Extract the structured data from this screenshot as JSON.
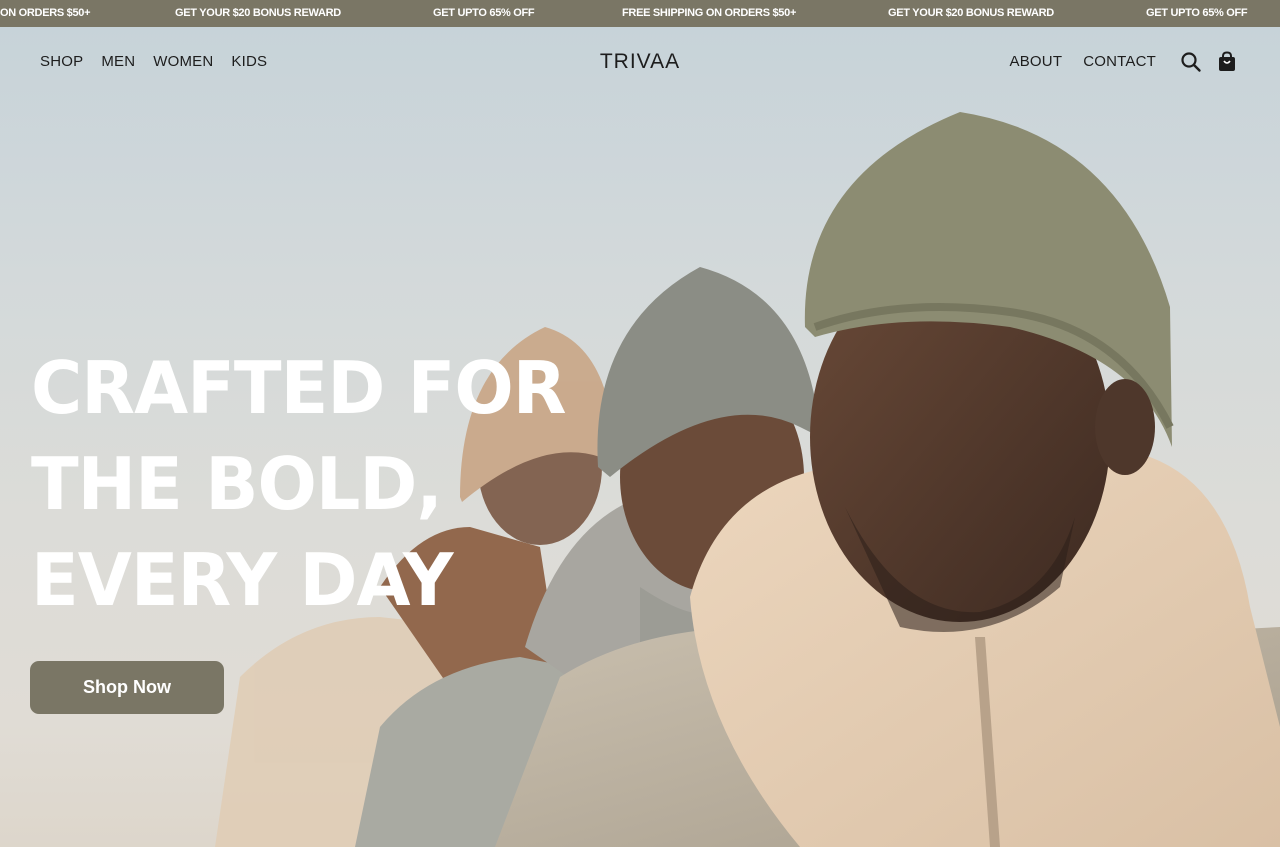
{
  "announcement_bar": {
    "messages": [
      "ON ORDERS $50+",
      "GET YOUR $20 BONUS REWARD",
      "GET UPTO 65% OFF",
      "FREE SHIPPING ON ORDERS $50+",
      "GET YOUR $20 BONUS REWARD",
      "GET UPTO 65% OFF"
    ]
  },
  "header": {
    "logo": "TRIVAA",
    "nav_left": [
      "SHOP",
      "MEN",
      "WOMEN",
      "KIDS"
    ],
    "nav_right": [
      "ABOUT",
      "CONTACT"
    ],
    "icons": [
      "search-icon",
      "shopping-bag-icon"
    ]
  },
  "hero": {
    "headline_lines": [
      "CRAFTED FOR",
      "THE BOLD,",
      "EVERY DAY"
    ],
    "cta_label": "Shop Now",
    "image": "three-men-in-beanies-and-puffer-jackets"
  },
  "colors": {
    "accent": "#7a7665",
    "text_dark": "#1d1d1d",
    "headline": "#ffffff"
  }
}
